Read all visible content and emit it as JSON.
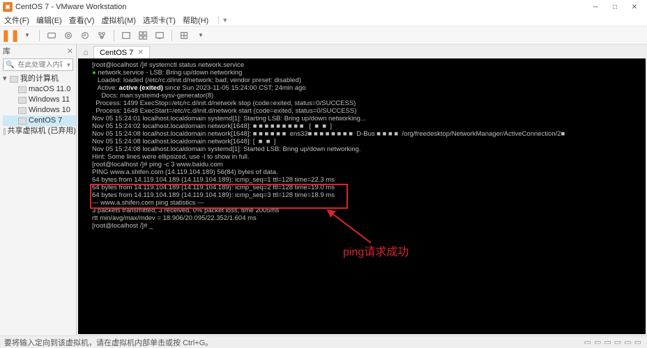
{
  "titlebar": {
    "title": "CentOS 7 - VMware Workstation"
  },
  "menubar": {
    "items": [
      {
        "label": "文件(F)"
      },
      {
        "label": "编辑(E)"
      },
      {
        "label": "查看(V)"
      },
      {
        "label": "虚拟机(M)"
      },
      {
        "label": "选项卡(T)"
      },
      {
        "label": "帮助(H)"
      }
    ]
  },
  "sidebar": {
    "title": "库",
    "search_placeholder": "在此处键入内容进行搜索",
    "tree": {
      "root": "我的计算机",
      "items": [
        {
          "label": "macOS 11.0"
        },
        {
          "label": "Windows 11"
        },
        {
          "label": "Windows 10"
        },
        {
          "label": "CentOS 7",
          "selected": true
        }
      ],
      "shared": "共享虚拟机 (已弃用)"
    }
  },
  "tabs": {
    "active": {
      "label": "CentOS 7"
    }
  },
  "terminal": {
    "lines": [
      "[root@localhost /]# systemctl status network.service",
      "● network.service - LSB: Bring up/down networking",
      "   Loaded: loaded (/etc/rc.d/init.d/network; bad; vendor preset: disabled)",
      "   Active: active (exited) since Sun 2023-11-05 15:24:00 CST; 24min ago",
      "     Docs: man:systemd-sysv-generator(8)",
      "  Process: 1499 ExecStop=/etc/rc.d/init.d/network stop (code=exited, status=0/SUCCESS)",
      "  Process: 1648 ExecStart=/etc/rc.d/init.d/network start (code=exited, status=0/SUCCESS)",
      "",
      "Nov 05 15:24:01 localhost.localdomain systemd[1]: Starting LSB: Bring up/down networking...",
      "Nov 05 15:24:02 localhost.localdomain network[1648]: ■ ■ ■ ■ ■ ■ ■ ■ ■   [  ■  ■  ]",
      "Nov 05 15:24:08 localhost.localdomain network[1648]: ■ ■ ■ ■ ■ ■  ens33■ ■ ■ ■ ■ ■ ■ ■  D-Bus ■ ■ ■ ■  /org/freedesktop/NetworkManager/ActiveConnection/2■",
      "Nov 05 15:24:08 localhost.localdomain network[1648]: [  ■  ■  ]",
      "Nov 05 15:24:08 localhost.localdomain systemd[1]: Started LSB: Bring up/down networking.",
      "Hint: Some lines were ellipsized, use -l to show in full.",
      "[root@localhost /]# ping -c 3 www.baidu.com",
      "PING www.a.shifen.com (14.119.104.189) 56(84) bytes of data.",
      "64 bytes from 14.119.104.189 (14.119.104.189): icmp_seq=1 ttl=128 time=22.3 ms",
      "64 bytes from 14.119.104.189 (14.119.104.189): icmp_seq=2 ttl=128 time=19.0 ms",
      "64 bytes from 14.119.104.189 (14.119.104.189): icmp_seq=3 ttl=128 time=18.9 ms",
      "",
      "--- www.a.shifen.com ping statistics ---",
      "3 packets transmitted, 3 received, 0% packet loss, time 2005ms",
      "rtt min/avg/max/mdev = 18.906/20.095/22.352/1.604 ms",
      "[root@localhost /]# _"
    ]
  },
  "annotation": {
    "text": "ping请求成功"
  },
  "statusbar": {
    "text": "要将输入定向到该虚拟机，请在虚拟机内部单击或按 Ctrl+G。"
  }
}
